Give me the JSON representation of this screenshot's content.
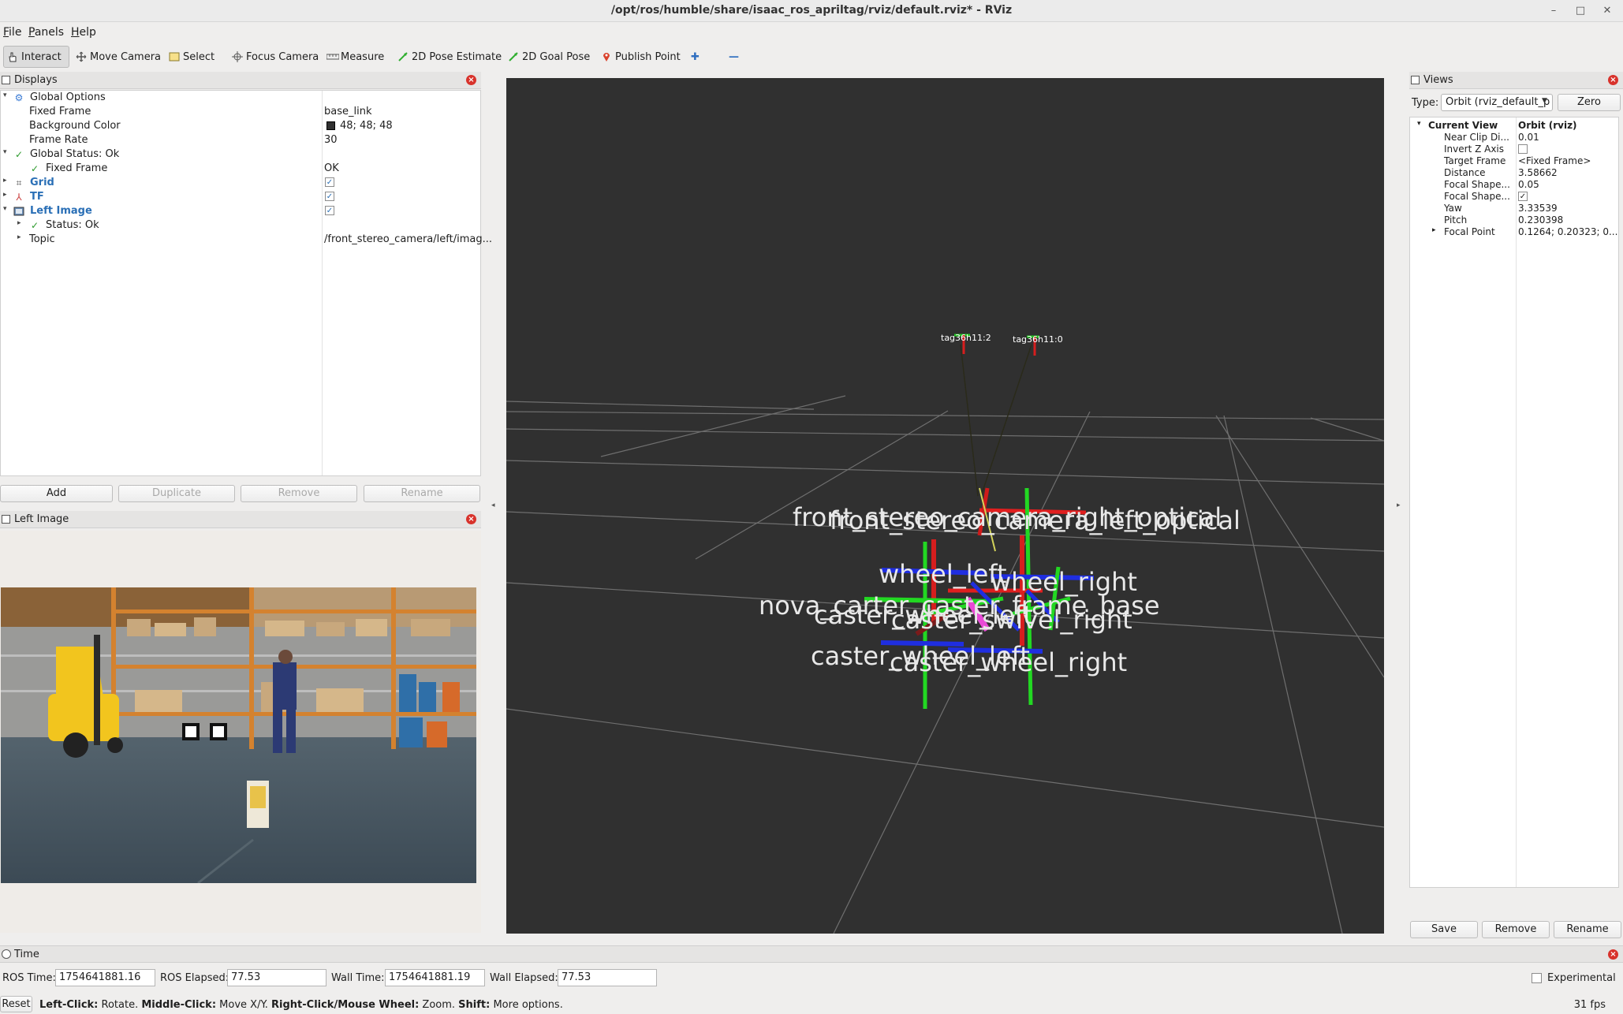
{
  "window": {
    "title": "/opt/ros/humble/share/isaac_ros_apriltag/rviz/default.rviz* - RViz",
    "min_glyph": "–",
    "max_glyph": "□",
    "close_glyph": "✕"
  },
  "menu": {
    "file": "File",
    "panels": "Panels",
    "help": "Help"
  },
  "toolbar": {
    "interact": "Interact",
    "move_camera": "Move Camera",
    "select": "Select",
    "focus_camera": "Focus Camera",
    "measure": "Measure",
    "pose_estimate": "2D Pose Estimate",
    "goal_pose": "2D Goal Pose",
    "publish_point": "Publish Point",
    "add_tool_glyph": "✚",
    "remove_tool_glyph": "—"
  },
  "displays": {
    "panel_title": "Displays",
    "global_options": "Global Options",
    "fixed_frame_key": "Fixed Frame",
    "fixed_frame_value": "base_link",
    "bg_color_key": "Background Color",
    "bg_color_value": "48; 48; 48",
    "bg_color_hex": "#303030",
    "frame_rate_key": "Frame Rate",
    "frame_rate_value": "30",
    "global_status": "Global Status: Ok",
    "gs_fixed_frame_key": "Fixed Frame",
    "gs_fixed_frame_value": "OK",
    "grid": "Grid",
    "tf": "TF",
    "left_image": "Left Image",
    "li_status": "Status: Ok",
    "li_topic_key": "Topic",
    "li_topic_value": "/front_stereo_camera/left/imag...",
    "check_glyph": "✓",
    "add": "Add",
    "duplicate": "Duplicate",
    "remove": "Remove",
    "rename": "Rename"
  },
  "image_panel": {
    "title": "Left Image"
  },
  "viewport": {
    "tag_labels": [
      "tag36h11:2",
      "tag36h11:0"
    ],
    "frame_labels": [
      "front_stereo_camera_right_optical",
      "front_stereo_camera_left_optical",
      "wheel_left",
      "wheel_right",
      "nova_carter_caster_frame_base",
      "caster_wheel_left",
      "caster_swivel_right",
      "caster_wheel_right"
    ]
  },
  "views": {
    "panel_title": "Views",
    "type_label": "Type:",
    "type_value": "Orbit (rviz_default_p",
    "zero": "Zero",
    "current_view": "Current View",
    "current_view_type": "Orbit (rviz)",
    "rows": [
      {
        "k": "Near Clip Di...",
        "v": "0.01"
      },
      {
        "k": "Invert Z Axis",
        "v": ""
      },
      {
        "k": "Target Frame",
        "v": "<Fixed Frame>"
      },
      {
        "k": "Distance",
        "v": "3.58662"
      },
      {
        "k": "Focal Shape...",
        "v": "0.05"
      },
      {
        "k": "Focal Shape...",
        "v": "✓"
      },
      {
        "k": "Yaw",
        "v": "3.33539"
      },
      {
        "k": "Pitch",
        "v": "0.230398"
      },
      {
        "k": "Focal Point",
        "v": "0.1264; 0.20323; 0..."
      }
    ],
    "save": "Save",
    "remove": "Remove",
    "rename": "Rename"
  },
  "time": {
    "panel_title": "Time",
    "ros_time_label": "ROS Time:",
    "ros_time": "1754641881.16",
    "ros_elapsed_label": "ROS Elapsed:",
    "ros_elapsed": "77.53",
    "wall_time_label": "Wall Time:",
    "wall_time": "1754641881.19",
    "wall_elapsed_label": "Wall Elapsed:",
    "wall_elapsed": "77.53",
    "experimental": "Experimental"
  },
  "status": {
    "reset": "Reset",
    "left_click": "Left-Click:",
    "left_click_desc": " Rotate. ",
    "middle_click": "Middle-Click:",
    "middle_click_desc": " Move X/Y. ",
    "right_click": "Right-Click/Mouse Wheel:",
    "right_click_desc": " Zoom. ",
    "shift": "Shift:",
    "shift_desc": " More options.",
    "fps": "31 fps"
  }
}
